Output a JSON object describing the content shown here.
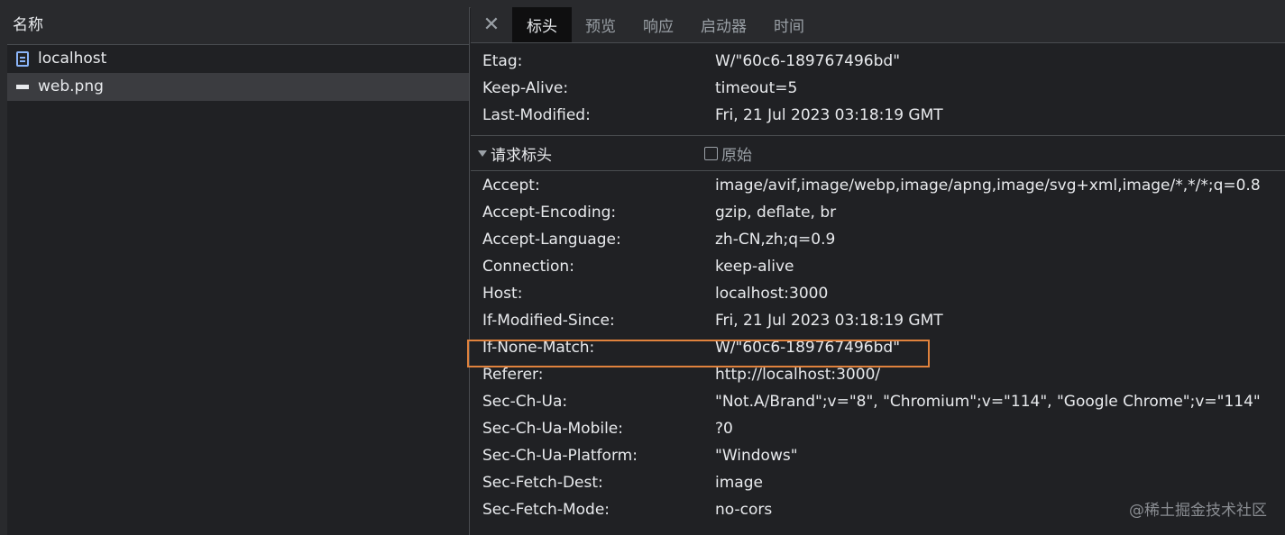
{
  "left": {
    "header": "名称",
    "requests": [
      {
        "name": "localhost",
        "icon": "document-icon"
      },
      {
        "name": "web.png",
        "icon": "image-icon"
      }
    ]
  },
  "tabs": {
    "close": "✕",
    "items": [
      "标头",
      "预览",
      "响应",
      "启动器",
      "时间"
    ],
    "active": "标头"
  },
  "response_headers": [
    {
      "name": "Etag:",
      "value": "W/\"60c6-189767496bd\""
    },
    {
      "name": "Keep-Alive:",
      "value": "timeout=5"
    },
    {
      "name": "Last-Modified:",
      "value": "Fri, 21 Jul 2023 03:18:19 GMT"
    }
  ],
  "request_section": {
    "title": "请求标头",
    "raw_label": "原始"
  },
  "request_headers": [
    {
      "name": "Accept:",
      "value": "image/avif,image/webp,image/apng,image/svg+xml,image/*,*/*;q=0.8"
    },
    {
      "name": "Accept-Encoding:",
      "value": "gzip, deflate, br"
    },
    {
      "name": "Accept-Language:",
      "value": "zh-CN,zh;q=0.9"
    },
    {
      "name": "Connection:",
      "value": "keep-alive"
    },
    {
      "name": "Host:",
      "value": "localhost:3000"
    },
    {
      "name": "If-Modified-Since:",
      "value": "Fri, 21 Jul 2023 03:18:19 GMT"
    },
    {
      "name": "If-None-Match:",
      "value": "W/\"60c6-189767496bd\""
    },
    {
      "name": "Referer:",
      "value": "http://localhost:3000/"
    },
    {
      "name": "Sec-Ch-Ua:",
      "value": "\"Not.A/Brand\";v=\"8\", \"Chromium\";v=\"114\", \"Google Chrome\";v=\"114\""
    },
    {
      "name": "Sec-Ch-Ua-Mobile:",
      "value": "?0"
    },
    {
      "name": "Sec-Ch-Ua-Platform:",
      "value": "\"Windows\""
    },
    {
      "name": "Sec-Fetch-Dest:",
      "value": "image"
    },
    {
      "name": "Sec-Fetch-Mode:",
      "value": "no-cors"
    }
  ],
  "highlight_color": "#e0823d",
  "watermark": "@稀土掘金技术社区"
}
